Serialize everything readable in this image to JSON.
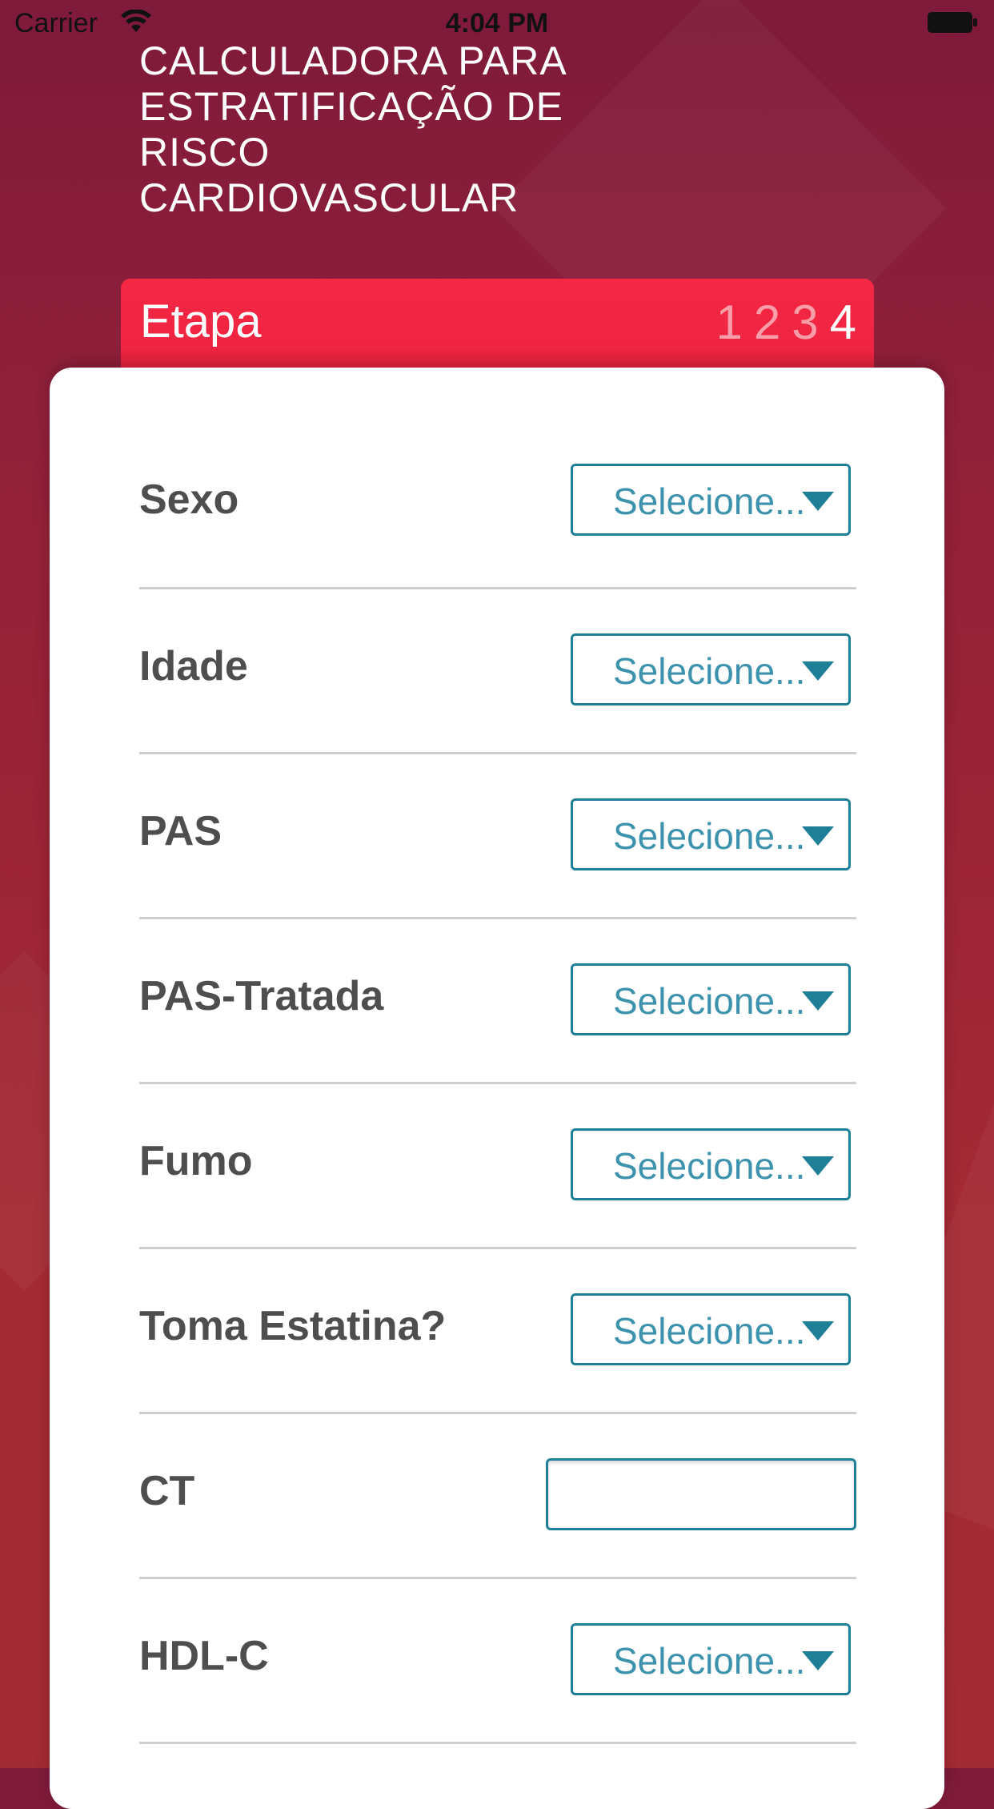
{
  "status_bar": {
    "carrier": "Carrier",
    "time": "4:04 PM"
  },
  "app": {
    "title_lines": [
      "CALCULADORA PARA",
      "ESTRATIFICAÇÃO DE",
      "RISCO",
      "CARDIOVASCULAR"
    ]
  },
  "step_header": {
    "label": "Etapa",
    "steps": [
      "1",
      "2",
      "3",
      "4"
    ],
    "current_step": 4
  },
  "form": {
    "rows": [
      {
        "label": "Sexo",
        "type": "select",
        "value": "Selecione..."
      },
      {
        "label": "Idade",
        "type": "select",
        "value": "Selecione..."
      },
      {
        "label": "PAS",
        "type": "select",
        "value": "Selecione..."
      },
      {
        "label": "PAS-Tratada",
        "type": "select",
        "value": "Selecione..."
      },
      {
        "label": "Fumo",
        "type": "select",
        "value": "Selecione..."
      },
      {
        "label": "Toma Estatina?",
        "type": "select",
        "value": "Selecione..."
      },
      {
        "label": "CT",
        "type": "text",
        "value": ""
      },
      {
        "label": "HDL-C",
        "type": "select",
        "value": "Selecione..."
      }
    ]
  },
  "colors": {
    "accent": "#1f7f97",
    "select_text": "#3d93ad",
    "header_red": "#f52844",
    "background": "#8e1f3a"
  }
}
